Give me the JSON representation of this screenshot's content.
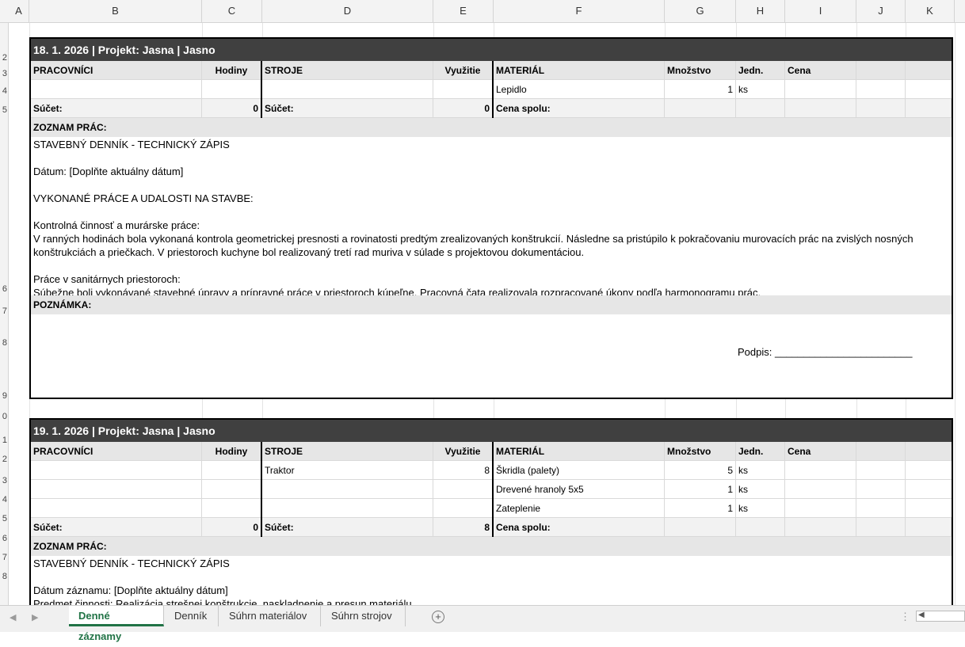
{
  "columns": [
    "A",
    "B",
    "C",
    "D",
    "E",
    "F",
    "G",
    "H",
    "I",
    "J",
    "K"
  ],
  "rows": [
    "2",
    "3",
    "4",
    "5",
    "6",
    "7",
    "8",
    "9",
    "0",
    "1",
    "2",
    "3",
    "4",
    "5",
    "6",
    "7",
    "8"
  ],
  "records": [
    {
      "title": "18. 1. 2026   |   Projekt: Jasna   |   Jasno",
      "headers": {
        "workers": "PRACOVNÍCI",
        "hours": "Hodiny",
        "machines": "STROJE",
        "usage": "Využitie",
        "material": "MATERIÁL",
        "qty": "Množstvo",
        "unit": "Jedn.",
        "price": "Cena"
      },
      "lines": [
        {
          "worker": "",
          "hours": "",
          "machine": "",
          "usage": "",
          "material": "Lepidlo",
          "qty": "1",
          "unit": "ks",
          "price": ""
        }
      ],
      "sum": {
        "label": "Súčet:",
        "hours": "0",
        "machines_label": "Súčet:",
        "usage": "0",
        "price_label": "Cena spolu:"
      },
      "worklist_label": "ZOZNAM PRÁC:",
      "worklist": [
        "  STAVEBNÝ DENNÍK - TECHNICKÝ ZÁPIS",
        "",
        "  Dátum: [Doplňte aktuálny dátum]",
        "",
        "  VYKONANÉ PRÁCE A UDALOSTI NA STAVBE:",
        "",
        "  Kontrolná činnosť a murárske práce:",
        "  V ranných hodinách bola vykonaná kontrola geometrickej presnosti a rovinatosti predtým zrealizovaných konštrukcií. Následne sa pristúpilo k pokračovaniu murovacích prác na zvislých nosných konštrukciách a priečkach. V priestoroch kuchyne bol realizovaný tretí rad muriva v súlade s projektovou dokumentáciou.",
        "",
        "  Práce v sanitárnych priestoroch:",
        "  Súbežne boli vykonávané stavebné úpravy a prípravné práce v priestoroch kúpeľne. Pracovná čata realizovala rozpracované úkony podľa harmonogramu prác."
      ],
      "note_label": "POZNÁMKA:",
      "signature": "Podpis: ________________________"
    },
    {
      "title": "19. 1. 2026   |   Projekt: Jasna   |   Jasno",
      "headers": {
        "workers": "PRACOVNÍCI",
        "hours": "Hodiny",
        "machines": "STROJE",
        "usage": "Využitie",
        "material": "MATERIÁL",
        "qty": "Množstvo",
        "unit": "Jedn.",
        "price": "Cena"
      },
      "lines": [
        {
          "worker": "",
          "hours": "",
          "machine": "Traktor",
          "usage": "8",
          "material": "Škridla (palety)",
          "qty": "5",
          "unit": "ks",
          "price": ""
        },
        {
          "worker": "",
          "hours": "",
          "machine": "",
          "usage": "",
          "material": "Drevené hranoly 5x5",
          "qty": "1",
          "unit": "ks",
          "price": ""
        },
        {
          "worker": "",
          "hours": "",
          "machine": "",
          "usage": "",
          "material": "Zateplenie",
          "qty": "1",
          "unit": "ks",
          "price": ""
        }
      ],
      "sum": {
        "label": "Súčet:",
        "hours": "0",
        "machines_label": "Súčet:",
        "usage": "8",
        "price_label": "Cena spolu:"
      },
      "worklist_label": "ZOZNAM PRÁC:",
      "worklist": [
        "  STAVEBNÝ DENNÍK - TECHNICKÝ ZÁPIS",
        "",
        "  Dátum záznamu: [Doplňte aktuálny dátum]",
        "  Predmet činnosti: Realizácia strešnej konštrukcie, naskladnenie a presun materiálu"
      ]
    }
  ],
  "sheet_tabs": [
    "Denné záznamy",
    "Denník",
    "Súhrn materiálov",
    "Súhrn strojov"
  ],
  "active_tab": "Denné záznamy",
  "icons": {
    "add_sheet": "plus-icon",
    "scroll_left": "arrow-left-icon",
    "scroll_right": "arrow-right-icon",
    "options": "more-vertical-icon"
  },
  "colors": {
    "title_bar": "#404040",
    "active_tab": "#217346",
    "header_fill": "#e6e6e6"
  }
}
